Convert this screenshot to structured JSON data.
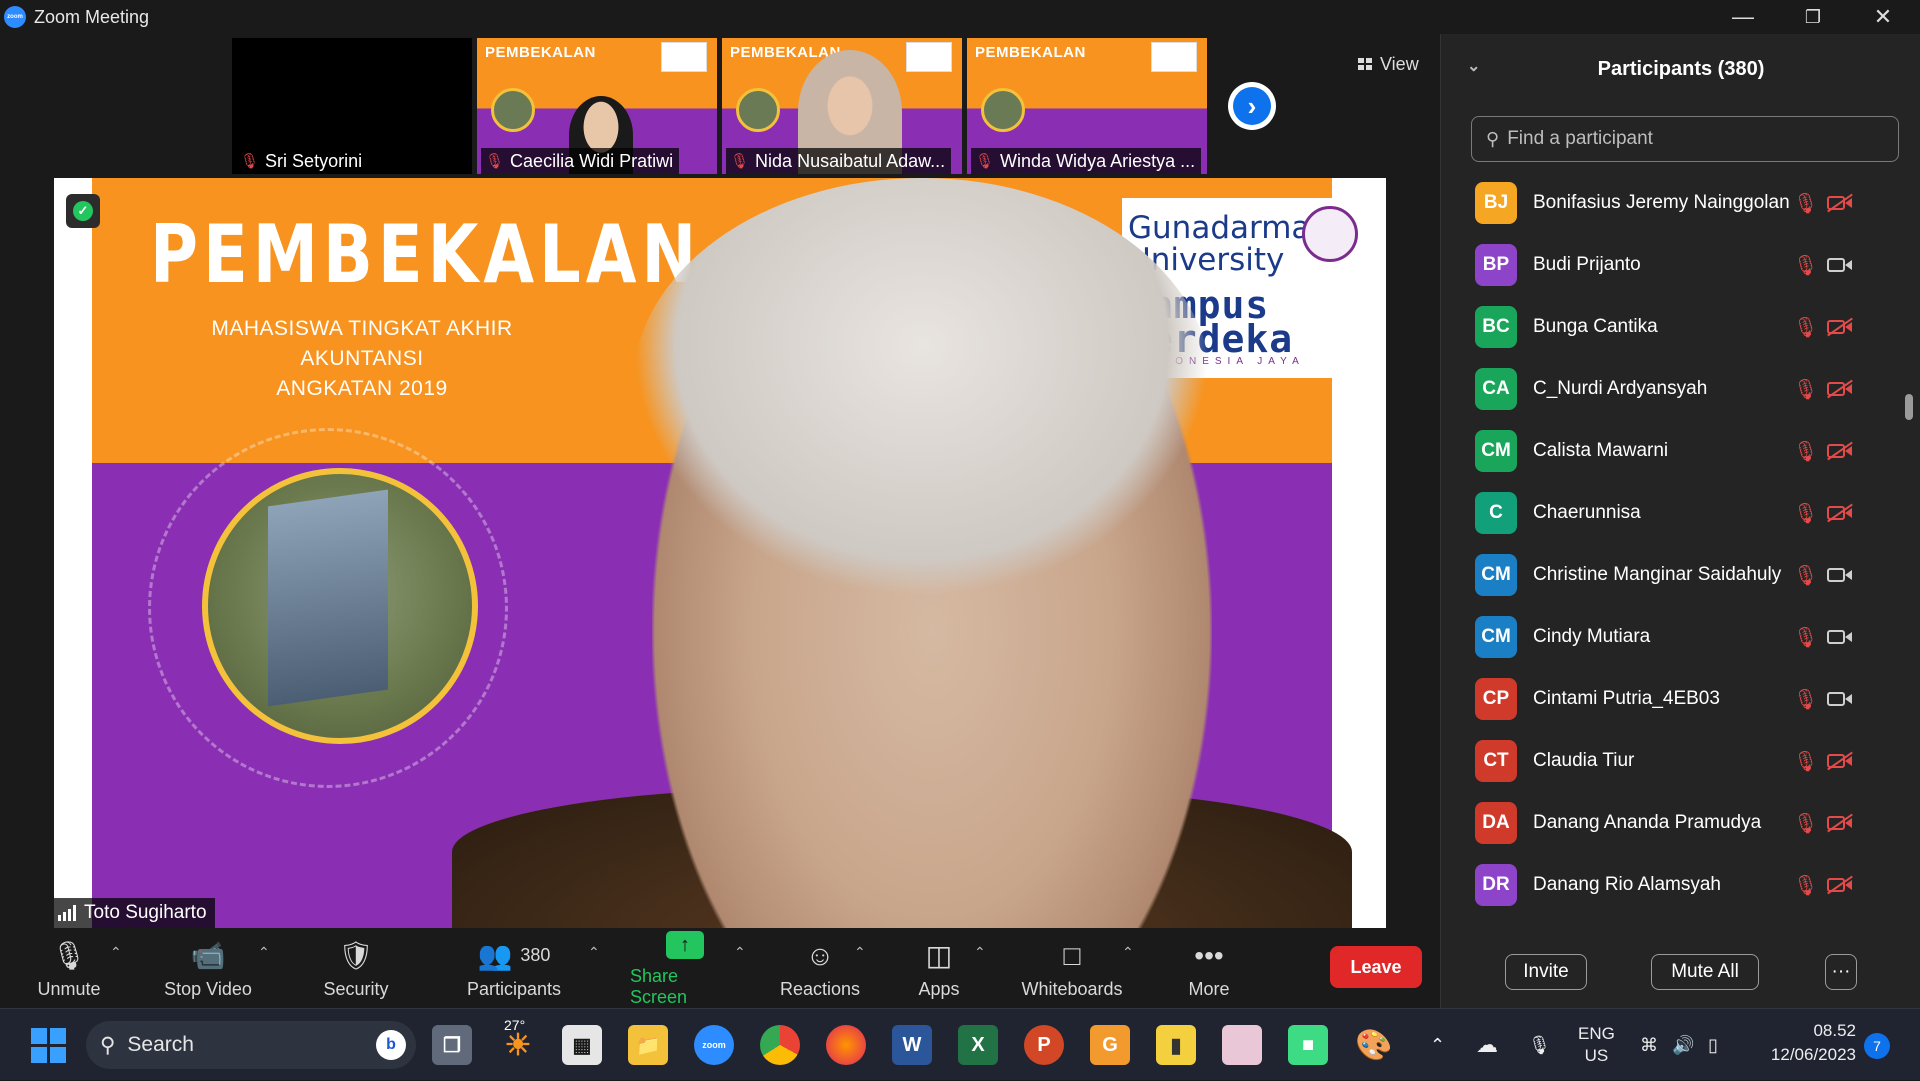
{
  "window": {
    "title": "Zoom Meeting",
    "app_logo_text": "zoom"
  },
  "thumbnails": [
    {
      "name": "Sri Setyorini",
      "muted": true,
      "video": false
    },
    {
      "name": "Caecilia Widi Pratiwi",
      "muted": true,
      "video": true,
      "slide_title": "PEMBEKALAN"
    },
    {
      "name": "Nida Nusaibatul Adaw...",
      "muted": true,
      "video": true,
      "slide_title": "PEMBEKALAN"
    },
    {
      "name": "Winda Widya Ariestya ...",
      "muted": true,
      "video": true,
      "slide_title": "PEMBEKALAN"
    }
  ],
  "view_button": {
    "label": "View",
    "icon": "grid-icon"
  },
  "main_video": {
    "slide_title": "PEMBEKALAN",
    "slide_subtitle_1": "MAHASISWA TINGKAT AKHIR AKUNTANSI",
    "slide_subtitle_2": "ANGKATAN 2019",
    "logo_university": "Gunadarma University",
    "logo_merdeka": "Kampus Merdeka",
    "logo_indonesia": "INDONESIA JAYA",
    "speaker_name": "Toto Sugiharto"
  },
  "toolbar": {
    "unmute": "Unmute",
    "stop_video": "Stop Video",
    "security": "Security",
    "participants": "Participants",
    "participants_count": "380",
    "share_screen": "Share Screen",
    "reactions": "Reactions",
    "apps": "Apps",
    "whiteboards": "Whiteboards",
    "more": "More",
    "leave": "Leave"
  },
  "panel": {
    "title": "Participants (380)",
    "search_placeholder": "Find a participant",
    "invite": "Invite",
    "mute_all": "Mute All",
    "more": "···",
    "participants": [
      {
        "initials": "BJ",
        "name": "Bonifasius Jeremy Nainggolan",
        "color": "#f5a623",
        "video_off": true
      },
      {
        "initials": "BP",
        "name": "Budi Prijanto",
        "color": "#8e44c9",
        "video_off": false
      },
      {
        "initials": "BC",
        "name": "Bunga Cantika",
        "color": "#1aa65a",
        "video_off": true
      },
      {
        "initials": "CA",
        "name": "C_Nurdi Ardyansyah",
        "color": "#1aa65a",
        "video_off": true
      },
      {
        "initials": "CM",
        "name": "Calista Mawarni",
        "color": "#1aa65a",
        "video_off": true
      },
      {
        "initials": "C",
        "name": "Chaerunnisa",
        "color": "#11a07a",
        "video_off": true
      },
      {
        "initials": "CM",
        "name": "Christine Manginar Saidahuly",
        "color": "#1a7fc4",
        "video_off": false
      },
      {
        "initials": "CM",
        "name": "Cindy Mutiara",
        "color": "#1a7fc4",
        "video_off": false
      },
      {
        "initials": "CP",
        "name": "Cintami Putria_4EB03",
        "color": "#d03a2a",
        "video_off": false
      },
      {
        "initials": "CT",
        "name": "Claudia Tiur",
        "color": "#d03a2a",
        "video_off": true
      },
      {
        "initials": "DA",
        "name": "Danang Ananda Pramudya",
        "color": "#d03a2a",
        "video_off": true
      },
      {
        "initials": "DR",
        "name": "Danang Rio Alamsyah",
        "color": "#8e44c9",
        "video_off": true
      }
    ]
  },
  "taskbar": {
    "search_label": "Search",
    "weather_temp": "27°",
    "language": "ENG",
    "region": "US",
    "time": "08.52",
    "date": "12/06/2023",
    "notification_count": "7"
  }
}
